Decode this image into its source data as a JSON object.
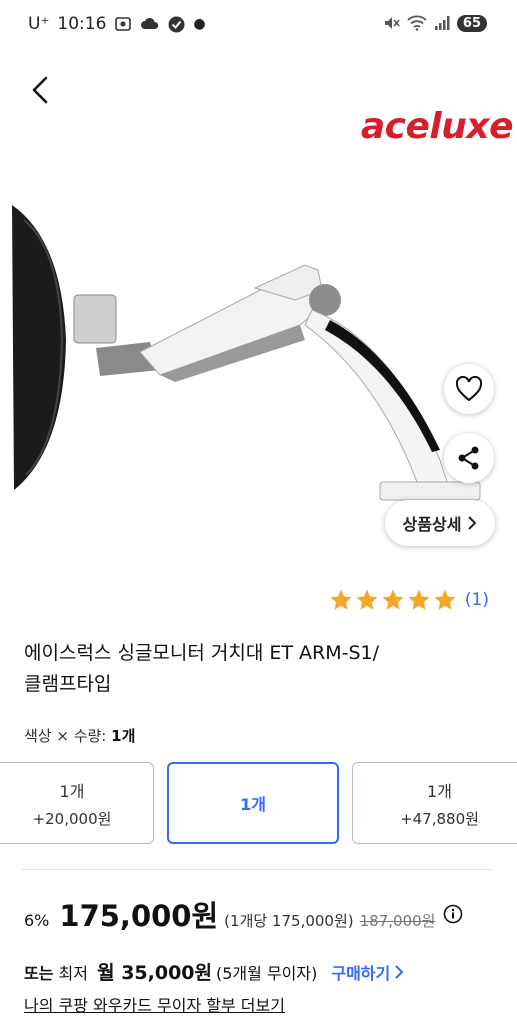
{
  "status_bar": {
    "carrier": "U⁺",
    "time": "10:16",
    "battery": "65"
  },
  "header": {
    "brand": "aceluxe"
  },
  "actions": {
    "detail_label": "상품상세"
  },
  "rating": {
    "stars": 5,
    "review_count": "(1)"
  },
  "product": {
    "title_line1": "에이스럭스 싱글모니터 거치대 ET ARM-S1/",
    "title_line2": "클램프타입"
  },
  "option": {
    "label_prefix": "색상 × 수량: ",
    "label_value": "1개",
    "choices": [
      {
        "label": "1개",
        "sub": "+20,000원"
      },
      {
        "label": "1개",
        "sub": ""
      },
      {
        "label": "1개",
        "sub": "+47,880원"
      }
    ],
    "selected_index": 1
  },
  "price": {
    "discount": "6%",
    "sale": "175,000원",
    "unit": "(1개당 175,000원)",
    "original": "187,000원"
  },
  "installment": {
    "prefix": "또는",
    "text1": "최저",
    "monthly": "월 35,000원",
    "months": "(5개월 무이자)",
    "buy_label": "구매하기"
  },
  "more_link": "나의 쿠팡 와우카드 무이자 할부 더보기",
  "colors": {
    "accent": "#346aff",
    "brand": "#d81e2a",
    "star": "#f5a623"
  }
}
